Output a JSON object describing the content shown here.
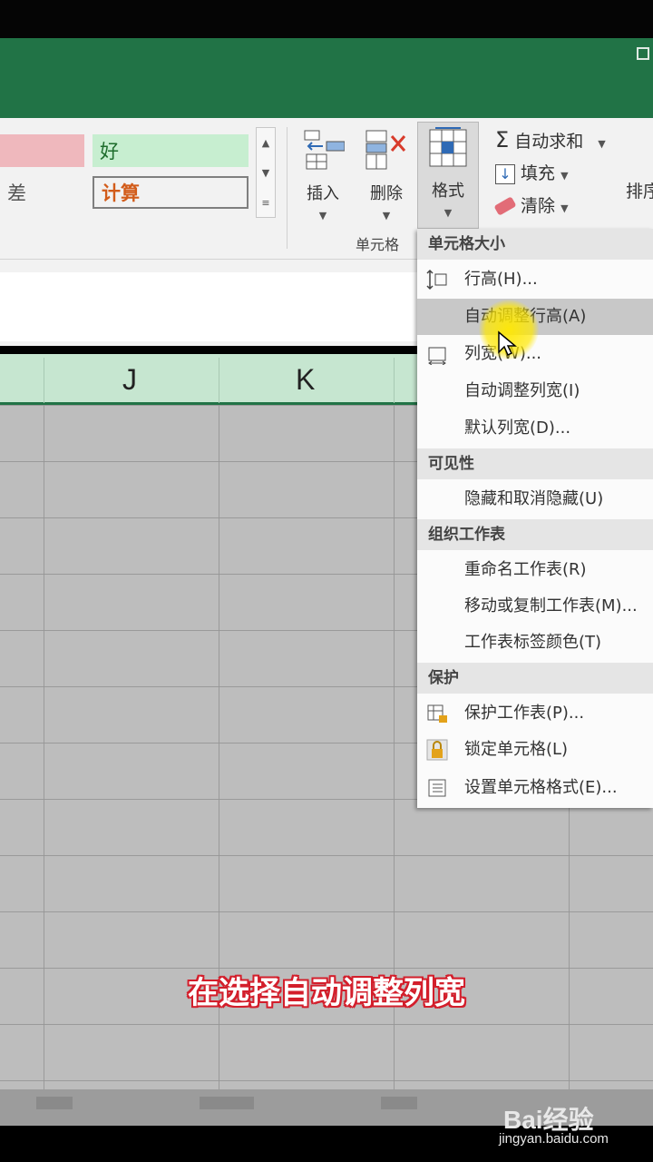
{
  "ribbon": {
    "styles": {
      "bad_partial": "差",
      "good": "好",
      "calculation": "计算"
    },
    "cells_group": {
      "insert_label": "插入",
      "delete_label": "删除",
      "format_label": "格式",
      "group_label": "单元格"
    },
    "editing": {
      "autosum_label": "自动求和",
      "fill_label": "填充",
      "clear_label": "清除",
      "sort_partial": "排序"
    }
  },
  "sheet": {
    "columns": [
      "J",
      "K"
    ]
  },
  "format_menu": {
    "sections": [
      {
        "header": "单元格大小",
        "items": [
          {
            "label": "行高(H)...",
            "icon": "row-height-icon"
          },
          {
            "label": "自动调整行高(A)",
            "icon": "",
            "highlighted": true
          },
          {
            "label": "列宽(W)...",
            "icon": "column-width-icon"
          },
          {
            "label": "自动调整列宽(I)",
            "icon": ""
          },
          {
            "label": "默认列宽(D)...",
            "icon": ""
          }
        ]
      },
      {
        "header": "可见性",
        "items": [
          {
            "label": "隐藏和取消隐藏(U)",
            "icon": ""
          }
        ]
      },
      {
        "header": "组织工作表",
        "items": [
          {
            "label": "重命名工作表(R)",
            "icon": ""
          },
          {
            "label": "移动或复制工作表(M)...",
            "icon": ""
          },
          {
            "label": "工作表标签颜色(T)",
            "icon": ""
          }
        ]
      },
      {
        "header": "保护",
        "items": [
          {
            "label": "保护工作表(P)...",
            "icon": "protect-sheet-icon"
          },
          {
            "label": "锁定单元格(L)",
            "icon": "lock-icon"
          },
          {
            "label": "设置单元格格式(E)...",
            "icon": "format-cells-icon"
          }
        ]
      }
    ]
  },
  "caption": "在选择自动调整列宽",
  "watermark": {
    "brand": "Bai经验",
    "url": "jingyan.baidu.com"
  },
  "colors": {
    "excel_green": "#217346",
    "caption_outline": "#d31e2b",
    "highlight": "#ffe800"
  }
}
